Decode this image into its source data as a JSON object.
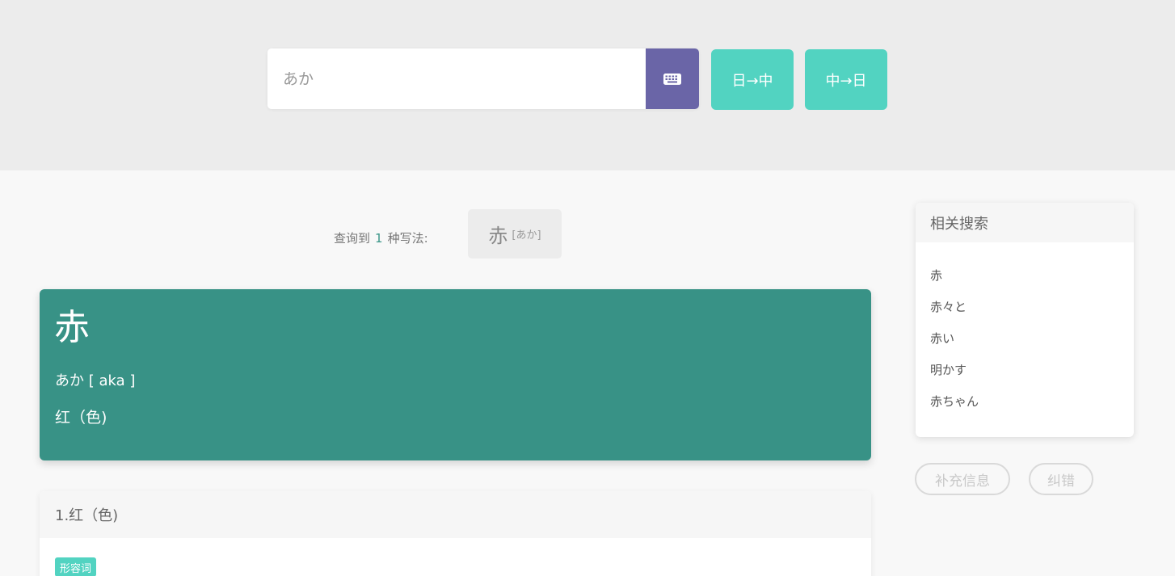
{
  "search": {
    "value": "",
    "placeholder": "あか",
    "keyboard_icon": "keyboard-icon",
    "btn_jp_to_cn": "日→中",
    "btn_cn_to_jp": "中→日"
  },
  "result_summary": {
    "prefix": "查询到",
    "count": "1",
    "suffix": "种写法:",
    "writings": [
      {
        "kanji": "赤",
        "kana": "[あか]"
      }
    ]
  },
  "word": {
    "headword": "赤",
    "reading": "あか [ aka ]",
    "meaning": "红（色)"
  },
  "definitions": [
    {
      "title": "1.红（色)",
      "pos": "形容词"
    }
  ],
  "related": {
    "title": "相关搜索",
    "items": [
      "赤",
      "赤々と",
      "赤い",
      "明かす",
      "赤ちゃん"
    ]
  },
  "actions": {
    "supplement": "补充信息",
    "report_error": "纠错"
  },
  "colors": {
    "accent_teal": "#52d3c1",
    "card_teal": "#389286",
    "keyboard_purple": "#6a65a7"
  }
}
